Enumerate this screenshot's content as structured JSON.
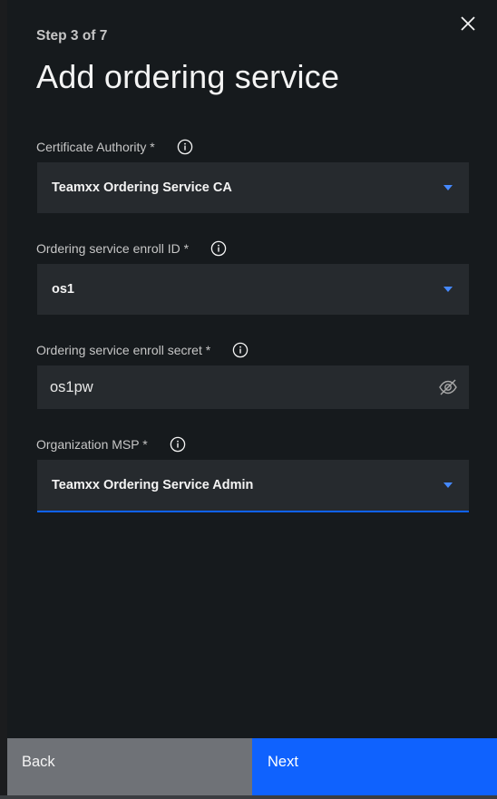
{
  "panel": {
    "step": "Step 3 of 7",
    "title": "Add ordering service"
  },
  "fields": [
    {
      "label": "Certificate Authority *",
      "value": "Teamxx Ordering Service CA",
      "type": "dropdown"
    },
    {
      "label": "Ordering service enroll ID *",
      "value": "os1",
      "type": "dropdown"
    },
    {
      "label": "Ordering service enroll secret *",
      "value": "os1pw",
      "type": "password"
    },
    {
      "label": "Organization MSP *",
      "value": "Teamxx Ordering Service Admin",
      "type": "dropdown"
    }
  ],
  "footer": {
    "back_label": "Back",
    "next_label": "Next"
  },
  "colors": {
    "panel_bg": "#161a1d",
    "field_bg": "#262a2e",
    "accent": "#0f62fe",
    "caret": "#4589ff",
    "back_bg": "#6f7277"
  },
  "icons": {
    "close": "close-icon",
    "info": "information-icon",
    "dropdown": "chevron-down-icon",
    "visibility": "eye-hidden-icon"
  }
}
